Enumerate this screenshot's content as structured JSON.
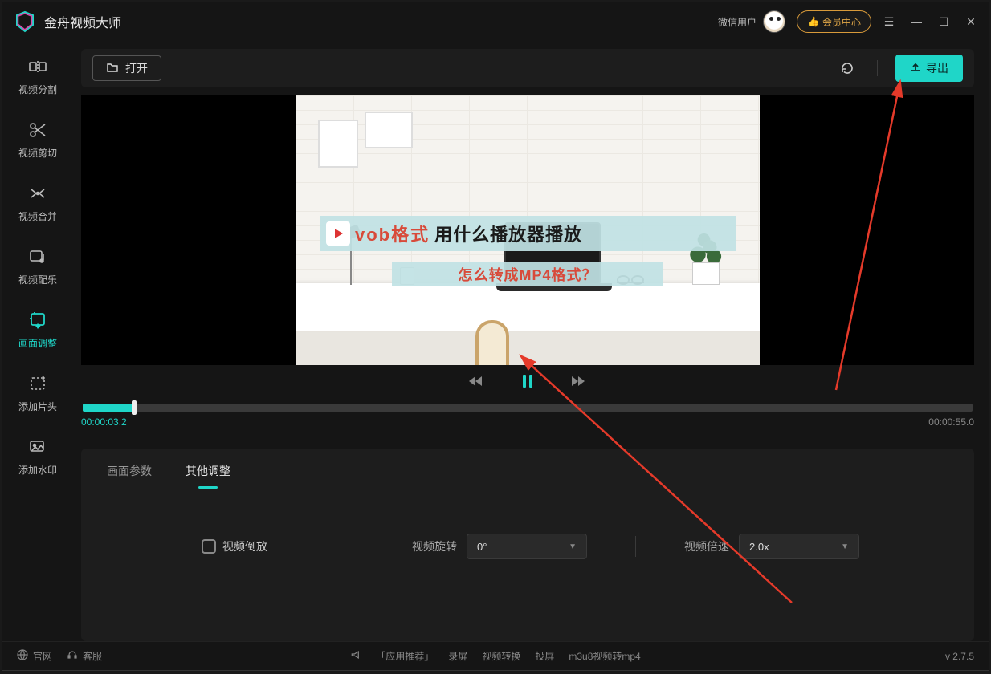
{
  "app": {
    "title": "金舟视频大师"
  },
  "titlebar": {
    "user_label": "微信用户",
    "vip_label": "会员中心"
  },
  "sidebar": {
    "items": [
      {
        "label": "视频分割"
      },
      {
        "label": "视频剪切"
      },
      {
        "label": "视频合并"
      },
      {
        "label": "视频配乐"
      },
      {
        "label": "画面调整"
      },
      {
        "label": "添加片头"
      },
      {
        "label": "添加水印"
      }
    ],
    "active_index": 4
  },
  "toolbar": {
    "open_label": "打开",
    "export_label": "导出"
  },
  "preview": {
    "overlay1_red": "vob格式",
    "overlay1_black": "用什么播放器播放",
    "overlay2": "怎么转成MP4格式？"
  },
  "timeline": {
    "current": "00:00:03.2",
    "duration": "00:00:55.0",
    "progress_pct": 5.8
  },
  "tabs": {
    "items": [
      "画面参数",
      "其他调整"
    ],
    "active_index": 1
  },
  "controls": {
    "reverse_label": "视频倒放",
    "rotate_label": "视频旋转",
    "rotate_value": "0°",
    "speed_label": "视频倍速",
    "speed_value": "2.0x"
  },
  "footer": {
    "site": "官网",
    "support": "客服",
    "promo_label": "「应用推荐」",
    "links": [
      "录屏",
      "视频转换",
      "投屏",
      "m3u8视频转mp4"
    ],
    "version": "v 2.7.5"
  },
  "colors": {
    "accent": "#1fd6c8",
    "vip": "#e2a848",
    "annotation": "#e53a2a"
  }
}
